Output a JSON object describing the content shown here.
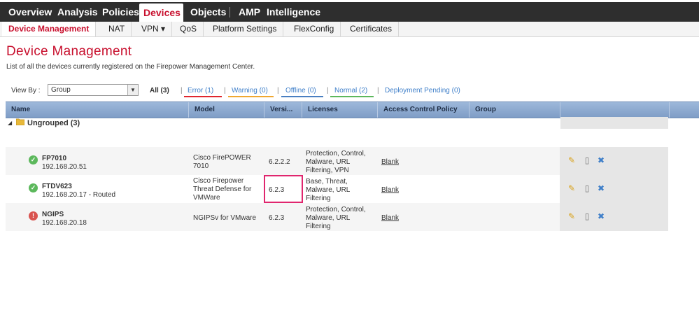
{
  "topnav": {
    "items": [
      "Overview",
      "Analysis",
      "Policies",
      "Devices",
      "Objects",
      "AMP",
      "Intelligence"
    ],
    "active": "Devices"
  },
  "subnav": {
    "items": [
      "Device Management",
      "NAT",
      "VPN ▾",
      "QoS",
      "Platform Settings",
      "FlexConfig",
      "Certificates"
    ],
    "active": "Device Management"
  },
  "page": {
    "title": "Device Management",
    "description": "List of all the devices currently registered on the Firepower Management Center."
  },
  "filterbar": {
    "view_by_label": "View By :",
    "view_by_value": "Group",
    "filters": [
      {
        "label": "All (3)",
        "color": "#333333"
      },
      {
        "label": "Error (1)",
        "color": "#e0262e"
      },
      {
        "label": "Warning (0)",
        "color": "#f0a830"
      },
      {
        "label": "Offline (0)",
        "color": "#4a7fc1"
      },
      {
        "label": "Normal (2)",
        "color": "#5cb85c"
      },
      {
        "label": "Deployment Pending (0)",
        "color": "#3f7fc9"
      }
    ]
  },
  "table": {
    "headers": [
      "Name",
      "Model",
      "Versi...",
      "Licenses",
      "Access Control Policy",
      "Group"
    ],
    "group": "Ungrouped (3)",
    "rows": [
      {
        "status": "ok",
        "name": "FP7010",
        "ip": "192.168.20.51",
        "model": [
          "Cisco FirePOWER",
          "7010"
        ],
        "version": "6.2.2.2",
        "licenses": [
          "Protection, Control,",
          "Malware, URL",
          "Filtering, VPN"
        ],
        "policy": "Blank"
      },
      {
        "status": "ok",
        "name": "FTDV623",
        "ip": "192.168.20.17 - Routed",
        "model": [
          "Cisco Firepower",
          "Threat Defense for",
          "VMWare"
        ],
        "version": "6.2.3",
        "licenses": [
          "Base, Threat,",
          "Malware, URL",
          "Filtering"
        ],
        "policy": "Blank"
      },
      {
        "status": "err",
        "name": "NGIPS",
        "ip": "192.168.20.18",
        "model": [
          "NGIPSv for VMware"
        ],
        "version": "6.2.3",
        "licenses": [
          "Protection, Control,",
          "Malware, URL",
          "Filtering"
        ],
        "policy": "Blank"
      }
    ],
    "actions": [
      "edit-icon",
      "delete-icon",
      "troubleshoot-icon"
    ]
  },
  "colors": {
    "brand": "#c8102e",
    "highlight": "#e0266e",
    "link": "#3f7fc9"
  }
}
